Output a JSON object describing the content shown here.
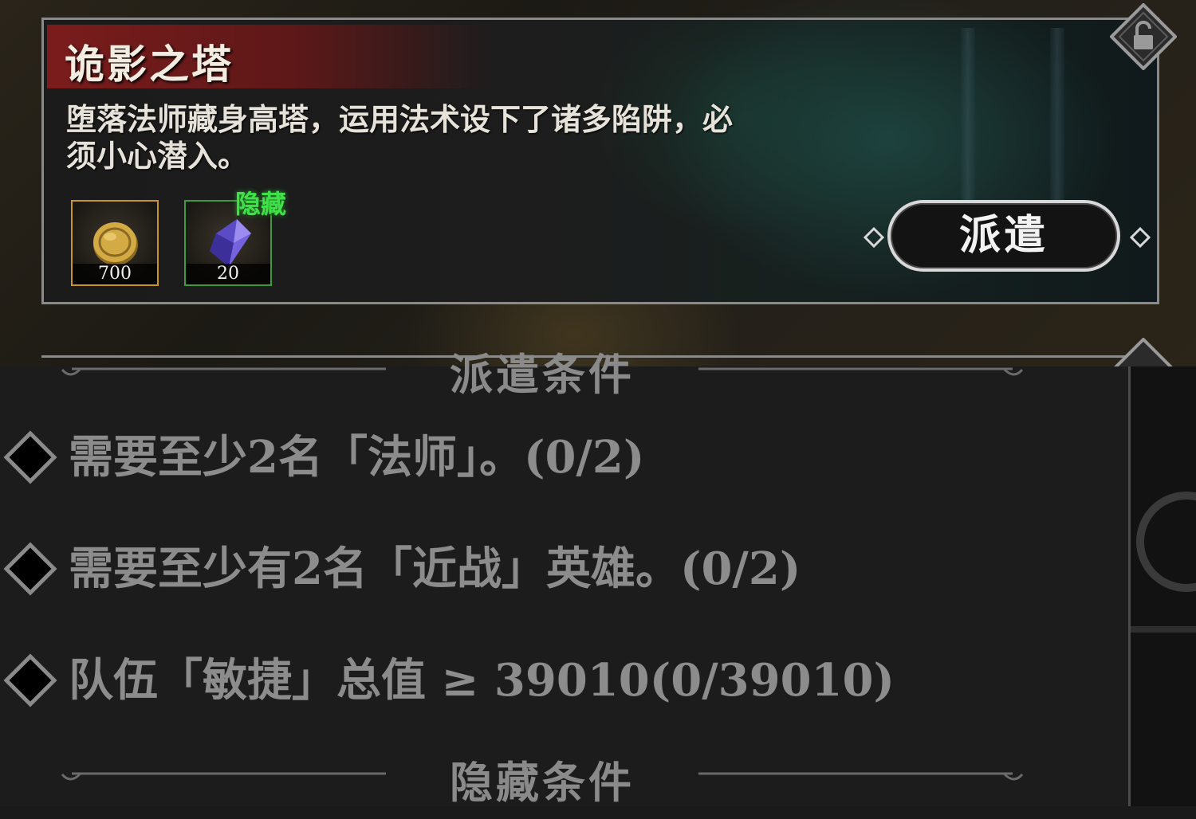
{
  "mission": {
    "title": "诡影之塔",
    "description": "堕落法师藏身高塔，运用法术设下了诸多陷阱，必须小心潜入。",
    "dispatch_label": "派遣",
    "rewards": [
      {
        "icon": "gold-coin-icon",
        "quantity": "700",
        "frame_color": "#c9932e"
      },
      {
        "icon": "crystal-icon",
        "quantity": "20",
        "frame_color": "#3e9a3a",
        "tag": "隐藏",
        "tag_color": "#41e04a"
      }
    ],
    "title_banner_color": "#7a1c1c",
    "lock_icon": "lock-icon"
  },
  "conditions": {
    "dispatch_title": "派遣条件",
    "items": [
      {
        "icon": "diamond-bullet-icon",
        "text": "需要至少2名「法师」。(0/2)"
      },
      {
        "icon": "diamond-bullet-icon",
        "text": "需要至少有2名「近战」英雄。(0/2)"
      },
      {
        "icon": "diamond-bullet-icon",
        "text": "队伍「敏捷」总值 ≥ 39010(0/39010)"
      }
    ],
    "hidden_title": "隐藏条件"
  }
}
